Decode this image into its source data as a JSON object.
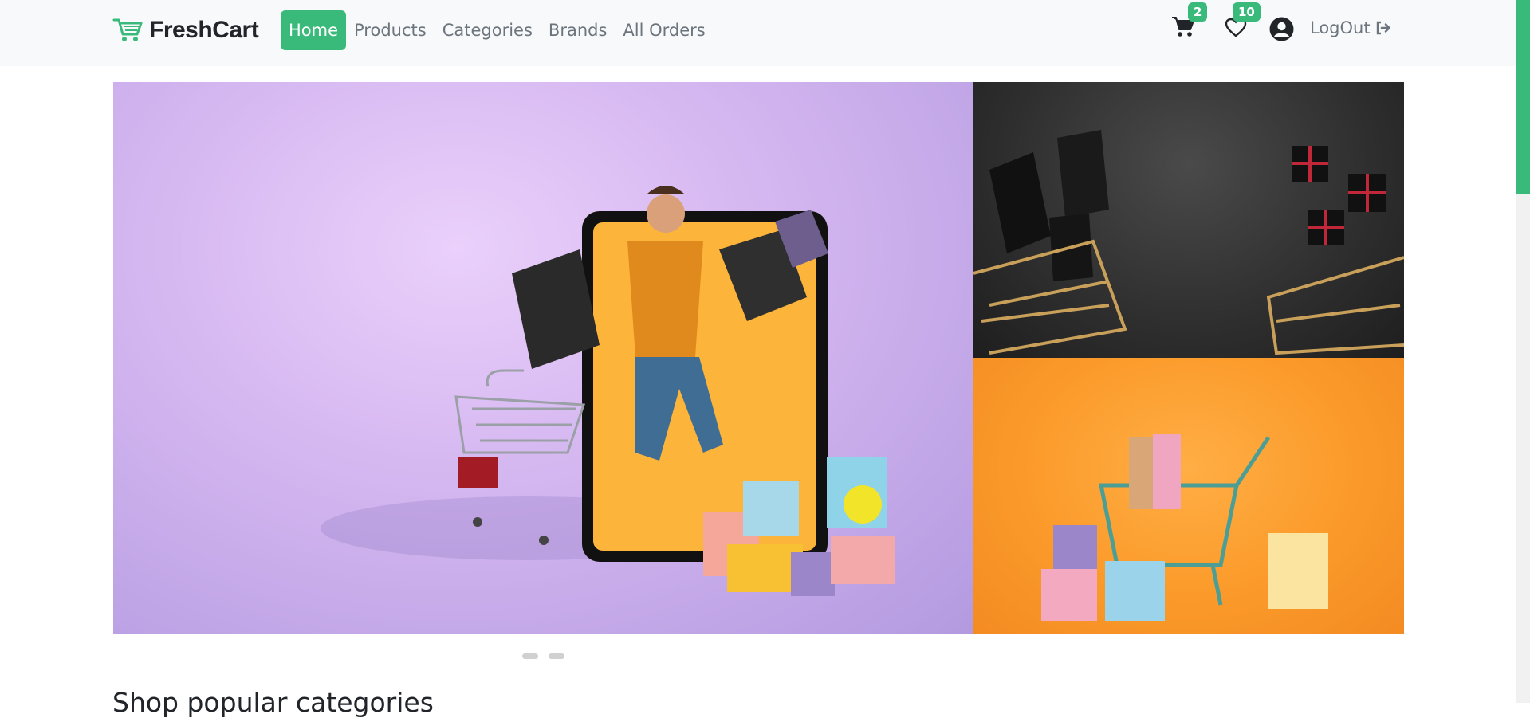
{
  "brand": {
    "name": "FreshCart",
    "color": "#3aba7a",
    "icon": "shopping-cart-icon"
  },
  "nav": {
    "items": [
      {
        "label": "Home",
        "active": true
      },
      {
        "label": "Products",
        "active": false
      },
      {
        "label": "Categories",
        "active": false
      },
      {
        "label": "Brands",
        "active": false
      },
      {
        "label": "All Orders",
        "active": false
      }
    ]
  },
  "actions": {
    "cart_count": "2",
    "wishlist_count": "10",
    "cart_icon": "cart-icon",
    "wishlist_icon": "heart-icon",
    "profile_icon": "user-circle-icon",
    "logout_label": "LogOut",
    "logout_icon": "sign-out-icon"
  },
  "slider": {
    "main_image": "man jumping out of tablet with shopping bags",
    "side_images": [
      "shopping carts and gift boxes on dark background",
      "shopping cart with gifts on orange background"
    ],
    "dots": 2
  },
  "section": {
    "title": "Shop popular categories"
  },
  "colors": {
    "accent": "#3aba7a",
    "navbar_bg": "#f8f9fa",
    "muted_text": "#6c757d"
  }
}
